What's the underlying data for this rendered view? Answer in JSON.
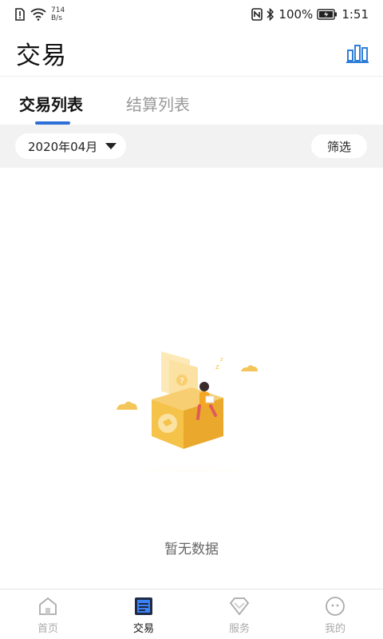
{
  "status_bar": {
    "net_speed_value": "714",
    "net_speed_unit": "B/s",
    "battery": "100%",
    "time": "1:51"
  },
  "header": {
    "title": "交易",
    "chart_icon": "bar-chart-icon"
  },
  "tabs": [
    {
      "label": "交易列表",
      "active": true
    },
    {
      "label": "结算列表",
      "active": false
    }
  ],
  "filter": {
    "date": "2020年04月",
    "filter_label": "筛选"
  },
  "empty_state": {
    "message": "暂无数据"
  },
  "bottom_nav": [
    {
      "label": "首页",
      "icon": "home-icon",
      "active": false
    },
    {
      "label": "交易",
      "icon": "transaction-icon",
      "active": true
    },
    {
      "label": "服务",
      "icon": "diamond-icon",
      "active": false
    },
    {
      "label": "我的",
      "icon": "profile-icon",
      "active": false
    }
  ],
  "colors": {
    "accent": "#2f6fd8",
    "illustration": "#f5c24a"
  }
}
